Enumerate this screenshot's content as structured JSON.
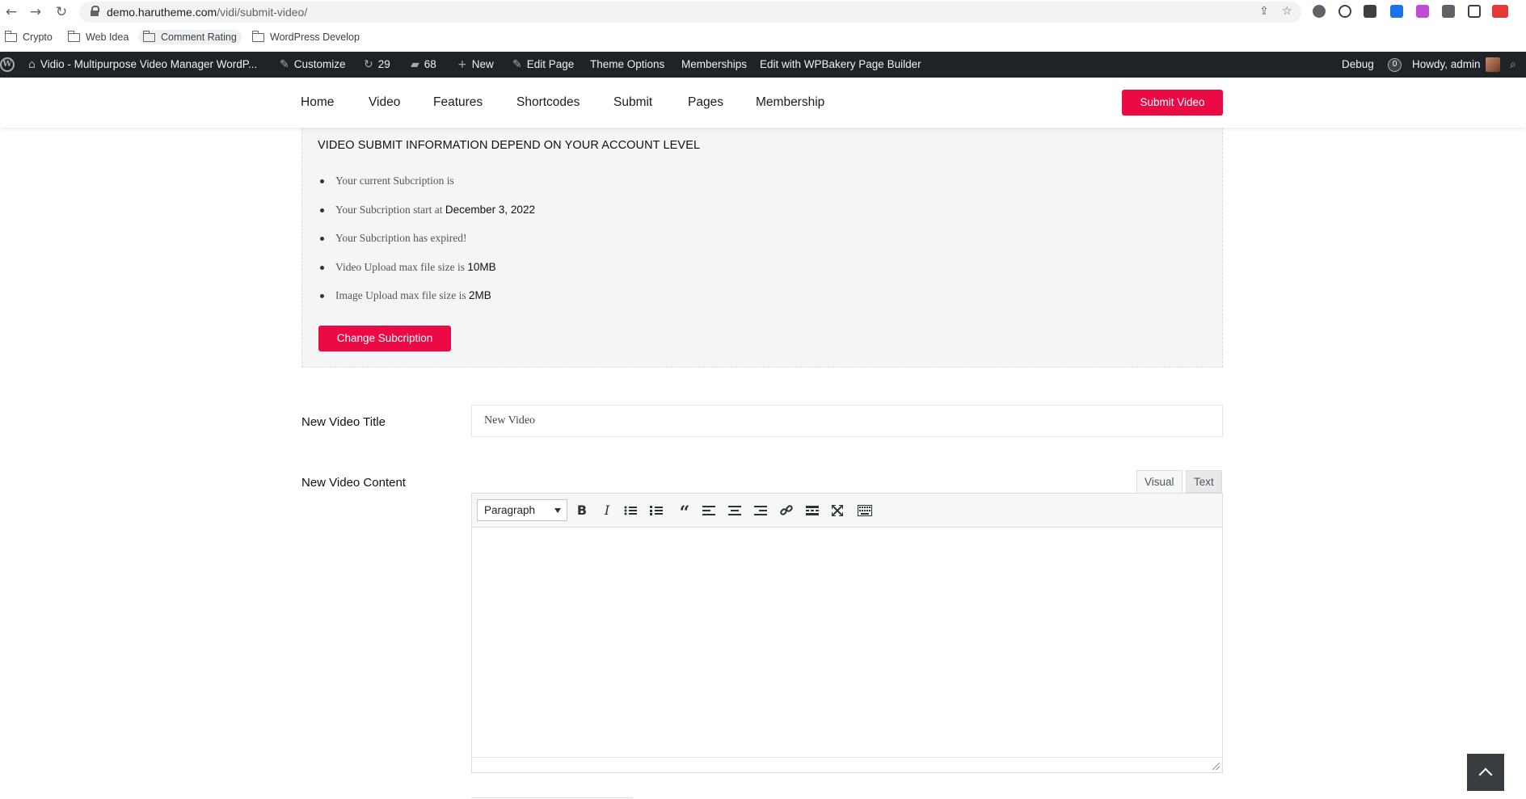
{
  "browser": {
    "url_host": "demo.harutheme.com",
    "url_path": "/vidi/submit-video/",
    "bookmarks": [
      "Crypto",
      "Web Idea",
      "Comment Rating",
      "WordPress Develop"
    ]
  },
  "adminbar": {
    "site_name": "Vidio - Multipurpose Video Manager WordP...",
    "customize": "Customize",
    "updates_count": "29",
    "comments_count": "68",
    "new": "New",
    "edit_page": "Edit Page",
    "theme_options": "Theme Options",
    "memberships": "Memberships",
    "wpbakery": "Edit with WPBakery Page Builder",
    "debug": "Debug",
    "debug_count": "0",
    "howdy": "Howdy, admin"
  },
  "site_nav": {
    "items": [
      "Home",
      "Video",
      "Features",
      "Shortcodes",
      "Submit",
      "Pages",
      "Membership"
    ],
    "submit_button": "Submit Video"
  },
  "info": {
    "title": "VIDEO SUBMIT INFORMATION DEPEND ON YOUR ACCOUNT LEVEL",
    "line1": "Your current Subcription is",
    "line2_prefix": "Your Subcription start at",
    "line2_value": "December 3, 2022",
    "line3": "Your Subcription has expired!",
    "line4_prefix": "Video Upload max file size is",
    "line4_value": "10MB",
    "line5_prefix": "Image Upload max file size is",
    "line5_value": "2MB",
    "change_button": "Change Subcription"
  },
  "form": {
    "title_label": "New Video Title",
    "title_value": "New Video",
    "content_label": "New Video Content",
    "tab_visual": "Visual",
    "tab_text": "Text",
    "format_value": "Paragraph"
  }
}
